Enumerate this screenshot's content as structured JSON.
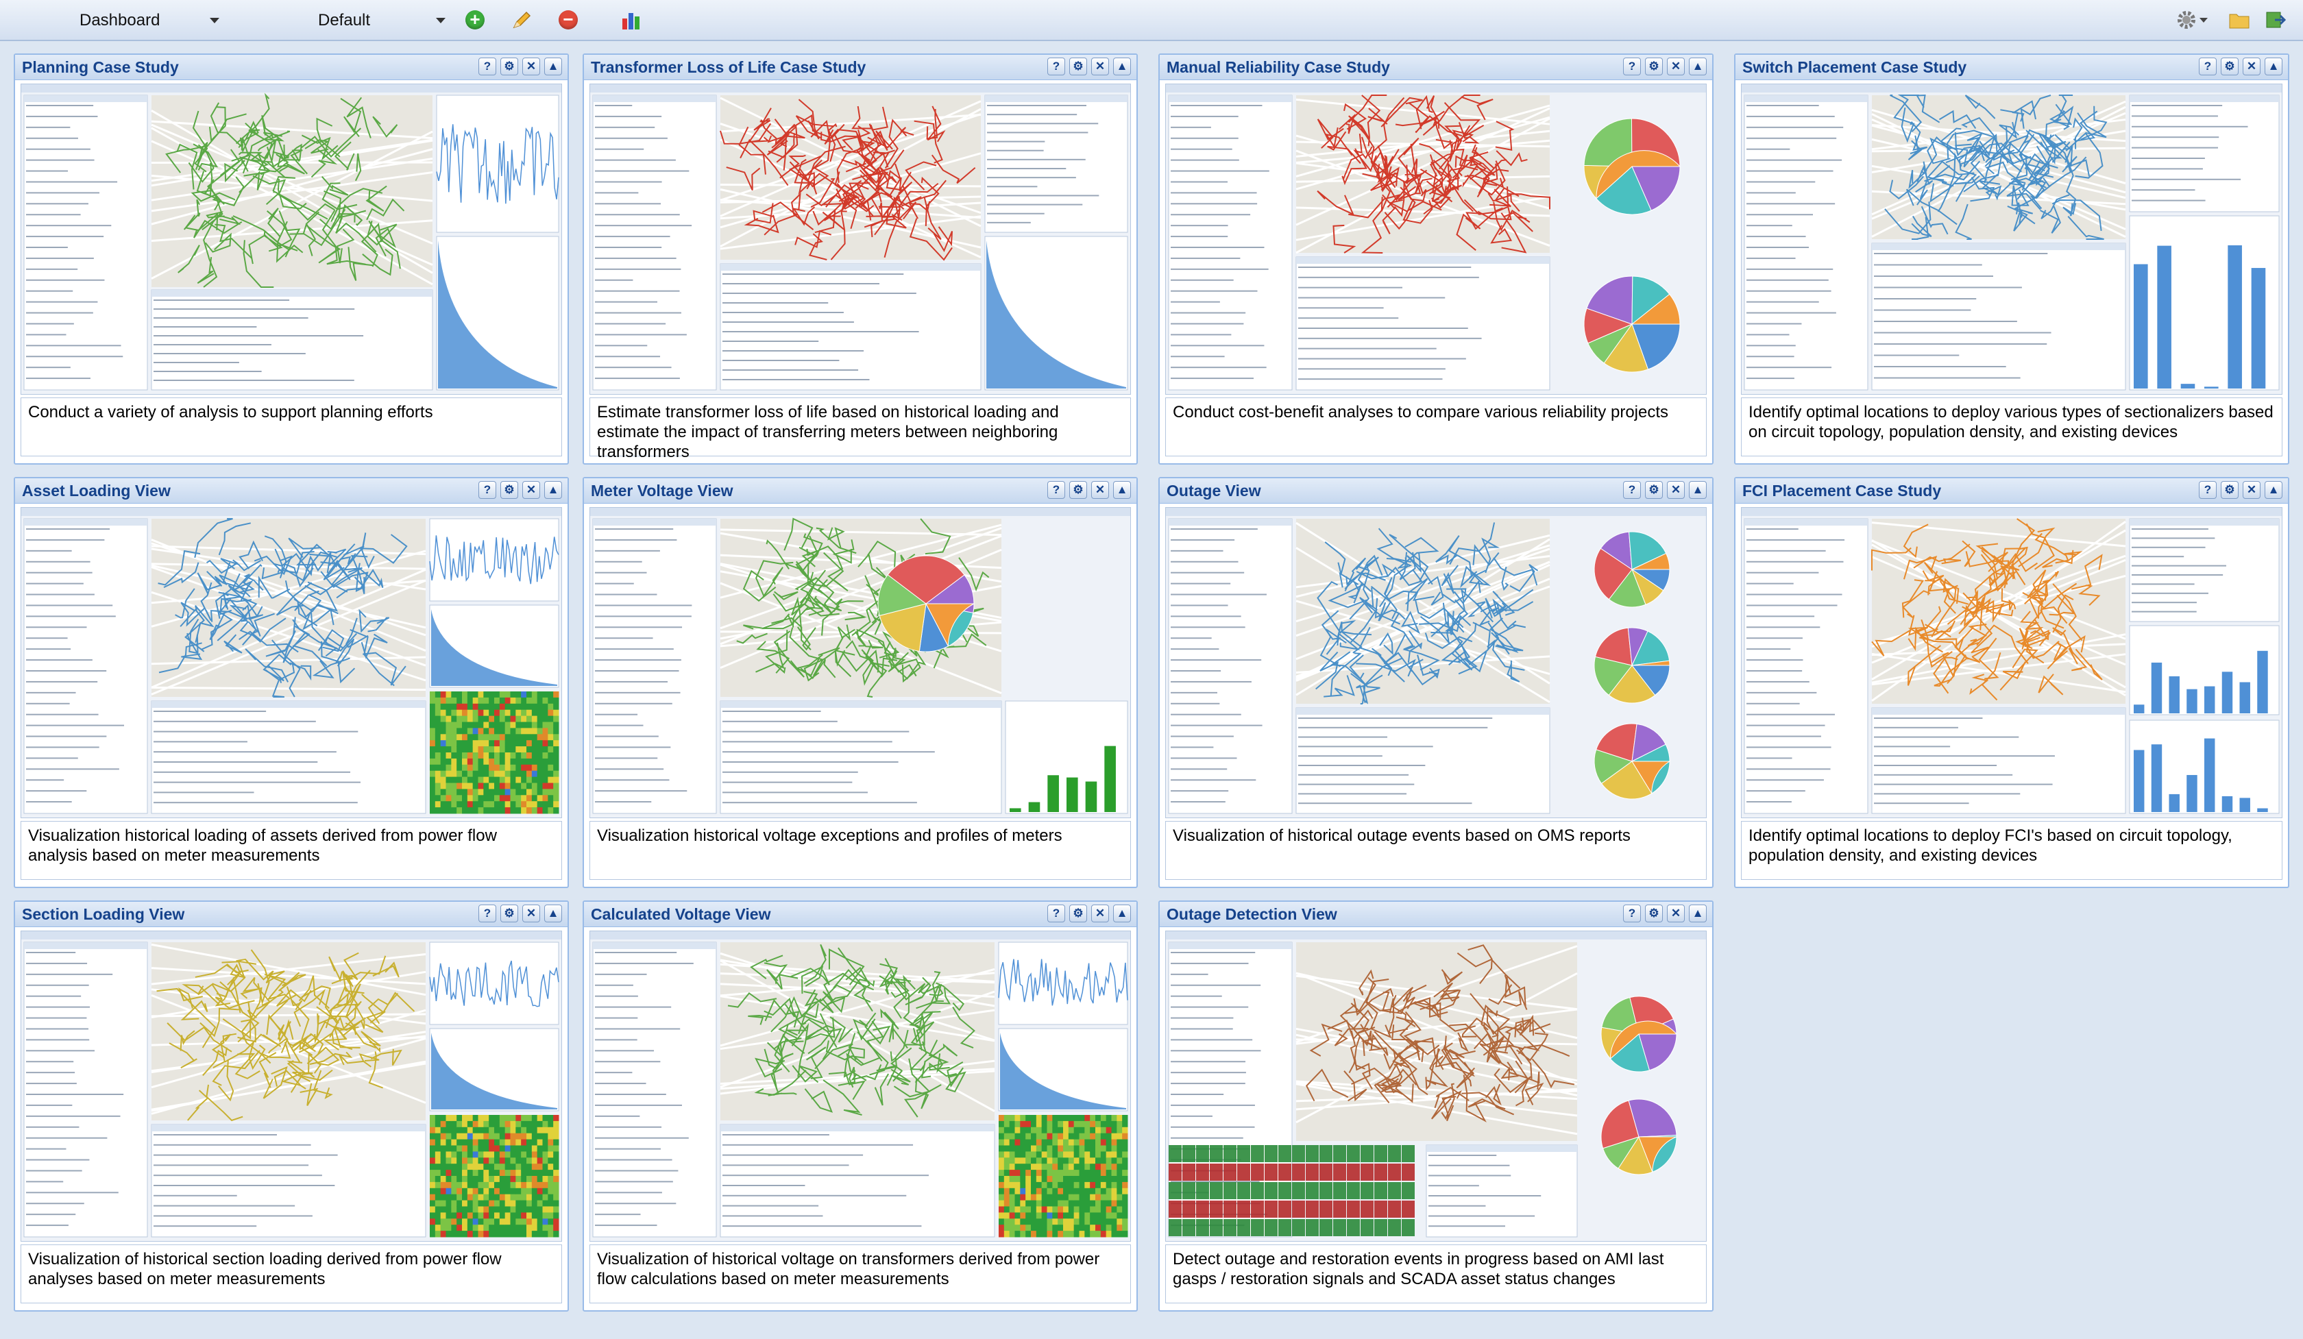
{
  "toolbar": {
    "dashboard_select": "Dashboard",
    "layout_select": "Default",
    "add_icon": "plus-circle-icon",
    "edit_icon": "pencil-icon",
    "remove_icon": "minus-circle-icon",
    "report_icon": "chart-icon",
    "settings_icon": "gear-icon",
    "folder_icon": "folder-icon",
    "export_icon": "export-icon"
  },
  "panel_tools": {
    "help": "?",
    "gear": "⚙",
    "close": "✕",
    "collapse": "▲"
  },
  "panels": [
    {
      "title": "Planning Case Study",
      "description": "Conduct a variety of analysis to support planning efforts"
    },
    {
      "title": "Transformer Loss of Life Case Study",
      "description": "Estimate transformer loss of life based on historical loading and estimate the impact of transferring meters between neighboring transformers"
    },
    {
      "title": "Manual Reliability Case Study",
      "description": "Conduct cost-benefit analyses to compare various reliability projects"
    },
    {
      "title": "Switch Placement Case Study",
      "description": "Identify optimal locations to deploy various types of sectionalizers based on circuit topology, population density, and existing devices"
    },
    {
      "title": "Asset Loading View",
      "description": "Visualization historical loading of assets derived from power flow analysis based on meter measurements"
    },
    {
      "title": "Meter Voltage View",
      "description": "Visualization historical voltage exceptions and profiles of meters"
    },
    {
      "title": "Outage View",
      "description": "Visualization of historical outage events based on OMS reports"
    },
    {
      "title": "FCI Placement Case Study",
      "description": "Identify optimal locations to deploy FCI's based on circuit topology, population density, and existing devices"
    },
    {
      "title": "Section Loading View",
      "description": "Visualization of historical section loading derived from power flow analyses based on meter measurements"
    },
    {
      "title": "Calculated Voltage View",
      "description": "Visualization of historical voltage on transformers derived from power flow calculations based on meter measurements"
    },
    {
      "title": "Outage Detection View",
      "description": "Detect outage and restoration events in progress based on AMI last gasps / restoration signals and SCADA asset status changes"
    }
  ],
  "thumb_colors": {
    "map_bg": "#e8e6df",
    "roads": "#ffffff",
    "feeder_blue": "#4a90c8",
    "feeder_green": "#5aa845",
    "feeder_red": "#d23a2a",
    "chart_blue": "#4f90d6",
    "chart_green": "#2b9e2b"
  }
}
